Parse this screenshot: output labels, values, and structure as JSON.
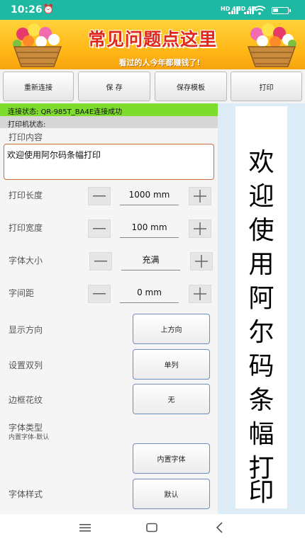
{
  "status_bar": {
    "time": "10:26",
    "network_1": "HD 4G",
    "network_2": "HD 4G",
    "icons": [
      "alarm-icon",
      "signal-icon",
      "wifi-icon",
      "battery-icon"
    ]
  },
  "banner": {
    "title": "常见问题点这里",
    "subtitle": "看过的人今年都赚钱了!"
  },
  "toolbar": {
    "reconnect_label": "重新连接",
    "save_label": "保 存",
    "save_template_label": "保存模板",
    "print_label": "打印"
  },
  "connection": {
    "status": "连接状态:  QR-985T_BA4E连接成功"
  },
  "printer": {
    "status_label": "打印机状态:"
  },
  "form": {
    "content_label": "打印内容",
    "content_value": "欢迎使用阿尔码条幅打印",
    "length_label": "打印长度",
    "length_value": "1000 mm",
    "width_label": "打印宽度",
    "width_value": "100 mm",
    "font_size_label": "字体大小",
    "font_size_value": "充满",
    "spacing_label": "字间距",
    "spacing_value": "0 mm",
    "direction_label": "显示方向",
    "direction_value": "上方向",
    "columns_label": "设置双列",
    "columns_value": "单列",
    "border_label": "边框花纹",
    "border_value": "无",
    "font_type_label": "字体类型",
    "font_type_sub": "内置字体-默认",
    "font_type_value": "内置字体",
    "font_style_label": "字体样式",
    "font_style_value": "默认"
  },
  "preview": {
    "chars": [
      "欢",
      "迎",
      "使",
      "用",
      "阿",
      "尔",
      "码",
      "条",
      "幅",
      "打",
      "印"
    ]
  },
  "colors": {
    "status_bar": "#1fb9a3",
    "banner_title": "#e0281c",
    "connection_ok": "#7ddc2e",
    "preview_bg": "#dcedf8",
    "input_border": "#cf6a3c",
    "option_border": "#6e8ebd"
  }
}
